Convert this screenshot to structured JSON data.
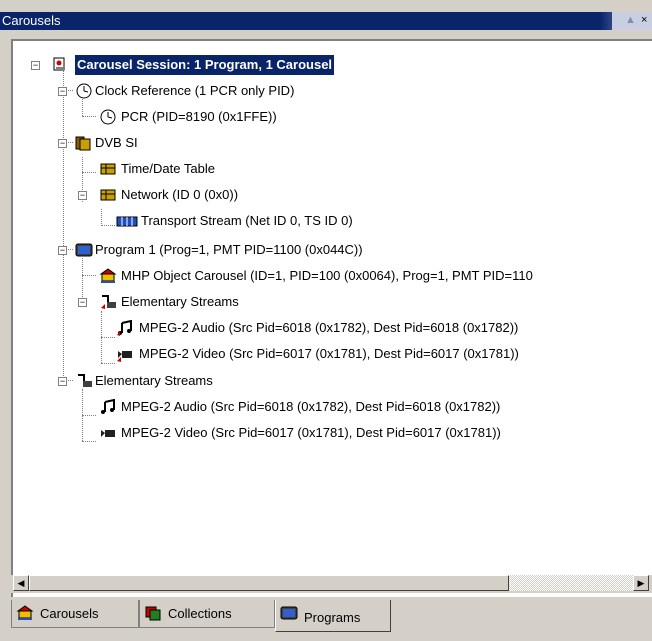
{
  "window": {
    "title": "Carousels",
    "pin_glyph": "▲",
    "close_glyph": "×"
  },
  "tree": {
    "root": "Carousel Session: 1 Program, 1 Carousel",
    "clock_ref": "Clock Reference (1 PCR only PID)",
    "pcr": "PCR (PID=8190 (0x1FFE))",
    "dvb_si": "DVB SI",
    "tdt": "Time/Date Table",
    "network": "Network (ID 0 (0x0))",
    "transport_stream": "Transport Stream (Net ID 0, TS ID 0)",
    "program1": "Program 1 (Prog=1, PMT PID=1100 (0x044C))",
    "mhp": "MHP Object Carousel (ID=1, PID=100 (0x0064), Prog=1, PMT PID=110",
    "es_prog": "Elementary Streams",
    "audio_prog": "MPEG-2 Audio (Src Pid=6018 (0x1782), Dest Pid=6018 (0x1782))",
    "video_prog": "MPEG-2 Video (Src Pid=6017 (0x1781), Dest Pid=6017 (0x1781))",
    "es_root": "Elementary Streams",
    "audio_root": "MPEG-2 Audio (Src Pid=6018 (0x1782), Dest Pid=6018 (0x1782))",
    "video_root": "MPEG-2 Video (Src Pid=6017 (0x1781), Dest Pid=6017 (0x1781))"
  },
  "scrollbar": {
    "left_arrow": "◀",
    "right_arrow": "▶"
  },
  "tabs": [
    {
      "label": "Carousels"
    },
    {
      "label": "Collections"
    },
    {
      "label": "Programs"
    }
  ],
  "colors": {
    "selection": "#0a246a",
    "titlebar": "#0a246a",
    "panel_bg": "#d4d0c8"
  }
}
